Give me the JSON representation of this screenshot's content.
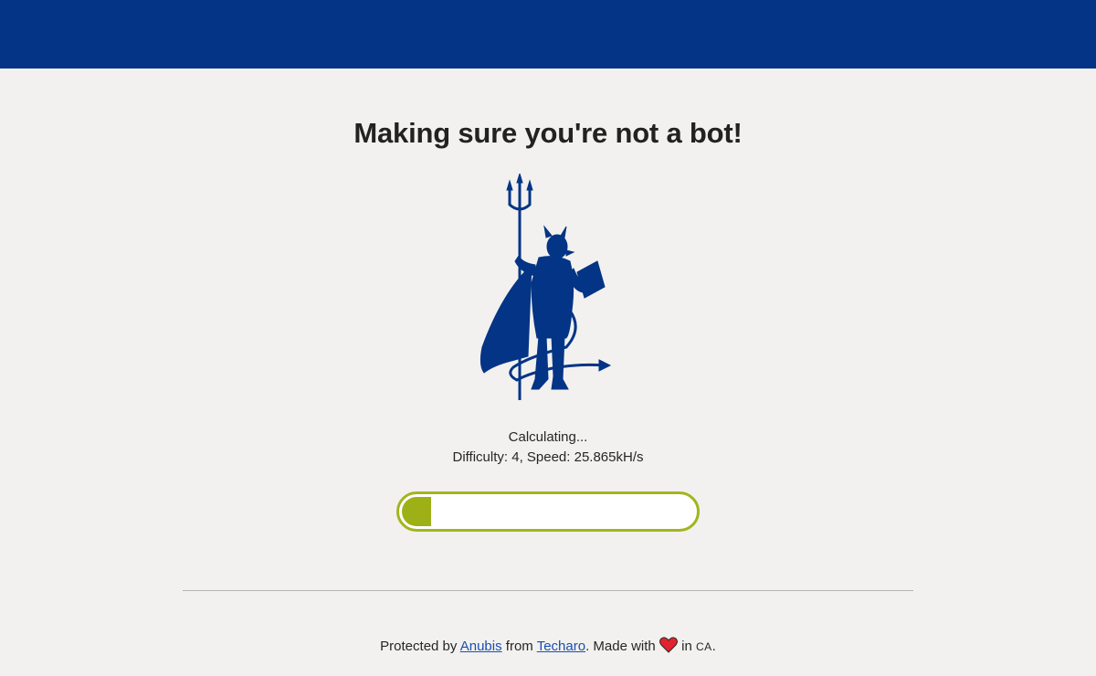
{
  "header": {
    "banner_color": "#043485"
  },
  "main": {
    "title": "Making sure you're not a bot!",
    "mascot_icon": "devil-reading-book-icon",
    "status_text": "Calculating...",
    "stats_text": "Difficulty: 4, Speed: 25.865kH/s",
    "progress": {
      "percent": 10,
      "color": "#9db117"
    }
  },
  "footer": {
    "prefix": "Protected by",
    "link_anubis": "Anubis",
    "middle": "from",
    "link_techaro": "Techaro",
    "made_with": ". Made with",
    "heart_icon": "heart-icon",
    "in": "in",
    "country": "CA",
    "end": "."
  },
  "colors": {
    "accent": "#043485",
    "background": "#f2f1ef",
    "progress": "#9db117",
    "link": "#1a4fb0"
  }
}
